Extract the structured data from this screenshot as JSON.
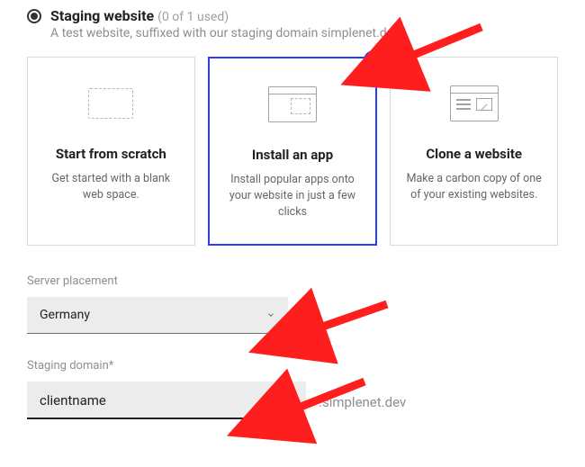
{
  "radio": {
    "title": "Staging website",
    "count": "(0 of 1 used)",
    "sub": "A test website, suffixed with our staging domain simplenet.dev"
  },
  "cards": [
    {
      "title": "Start from scratch",
      "desc": "Get started with a blank web space."
    },
    {
      "title": "Install an app",
      "desc": "Install popular apps onto your website in just a few clicks"
    },
    {
      "title": "Clone a website",
      "desc": "Make a carbon copy of one of your existing websites."
    }
  ],
  "fields": {
    "server_label": "Server placement",
    "server_value": "Germany",
    "domain_label": "Staging domain*",
    "domain_value": "clientname",
    "domain_suffix": ".simplenet.dev"
  }
}
